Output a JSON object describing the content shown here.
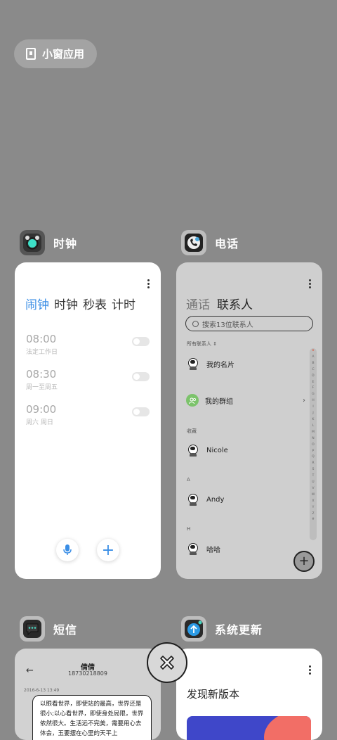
{
  "floating_chip": {
    "label": "小窗应用"
  },
  "apps": {
    "clock": {
      "title": "时钟",
      "tabs": [
        "闹钟",
        "时钟",
        "秒表",
        "计时"
      ],
      "alarms": [
        {
          "time": "08:00",
          "repeat": "法定工作日",
          "enabled": false
        },
        {
          "time": "08:30",
          "repeat": "周一至周五",
          "enabled": false
        },
        {
          "time": "09:00",
          "repeat": "周六 周日",
          "enabled": false
        }
      ],
      "add_label": "+"
    },
    "phone": {
      "title": "电话",
      "tabs": [
        "通话",
        "联系人"
      ],
      "search_placeholder": "搜索13位联系人",
      "all_contacts_label": "所有联系人",
      "my_card": "我的名片",
      "my_groups": "我的群组",
      "favorites_label": "收藏",
      "contacts": [
        {
          "section": "",
          "name": "Nicole"
        },
        {
          "section": "A",
          "name": "Andy"
        },
        {
          "section": "H",
          "name": "哈哈"
        }
      ],
      "alphabet": [
        "★",
        "A",
        "B",
        "C",
        "D",
        "E",
        "F",
        "G",
        "H",
        "I",
        "J",
        "K",
        "L",
        "M",
        "N",
        "O",
        "P",
        "Q",
        "R",
        "S",
        "T",
        "U",
        "V",
        "W",
        "X",
        "Y",
        "Z",
        "#"
      ],
      "add_label": "+"
    },
    "sms": {
      "title": "短信",
      "contact_name": "倩倩",
      "contact_number": "18730218809",
      "date": "2016-6-13 13:49",
      "message": "以眼看世界，即使站的最高，世界还是很小;以心看世界，即使身处局限，世界依然很大。生活远不完美，需要用心去体会，玉要摆在心里的天平上"
    },
    "update": {
      "title": "系统更新",
      "heading": "发现新版本"
    }
  },
  "colors": {
    "accent": "#3a8ee6",
    "background": "#8a8a8a",
    "group_green": "#7cc36b"
  }
}
